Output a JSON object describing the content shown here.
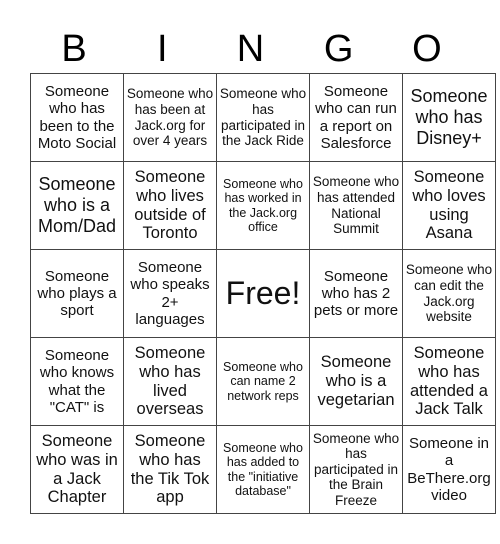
{
  "header": {
    "letters": [
      "B",
      "I",
      "N",
      "G",
      "O"
    ]
  },
  "board": {
    "rows": [
      [
        {
          "text": "Someone who has been to the Moto Social",
          "size": "md"
        },
        {
          "text": "Someone who has been at Jack.org for over 4 years",
          "size": "sm"
        },
        {
          "text": "Someone who has participated in the Jack Ride",
          "size": "sm"
        },
        {
          "text": "Someone who can run a report on Salesforce",
          "size": "md"
        },
        {
          "text": "Someone who has Disney+",
          "size": "xl"
        }
      ],
      [
        {
          "text": "Someone who is a Mom/Dad",
          "size": "xl"
        },
        {
          "text": "Someone who lives outside of Toronto",
          "size": "lg"
        },
        {
          "text": "Someone who has worked in the Jack.org office",
          "size": "xs"
        },
        {
          "text": "Someone who has attended National Summit",
          "size": "sm"
        },
        {
          "text": "Someone who loves using Asana",
          "size": "lg"
        }
      ],
      [
        {
          "text": "Someone who plays a sport",
          "size": "md"
        },
        {
          "text": "Someone who speaks 2+ languages",
          "size": "md"
        },
        {
          "text": "Free!",
          "size": "free"
        },
        {
          "text": "Someone who has 2 pets or more",
          "size": "md"
        },
        {
          "text": "Someone who can edit the Jack.org website",
          "size": "sm"
        }
      ],
      [
        {
          "text": "Someone who knows what the \"CAT\" is",
          "size": "md"
        },
        {
          "text": "Someone who has lived overseas",
          "size": "lg"
        },
        {
          "text": "Someone who can name 2 network reps",
          "size": "xs"
        },
        {
          "text": "Someone who is a vegetarian",
          "size": "lg"
        },
        {
          "text": "Someone who has attended a Jack Talk",
          "size": "lg"
        }
      ],
      [
        {
          "text": "Someone who was in a Jack Chapter",
          "size": "lg"
        },
        {
          "text": "Someone who has the Tik Tok app",
          "size": "lg"
        },
        {
          "text": "Someone who has added to the \"initiative database\"",
          "size": "xs"
        },
        {
          "text": "Someone who has participated in the Brain Freeze",
          "size": "sm"
        },
        {
          "text": "Someone in a BeThere.org video",
          "size": "md"
        }
      ]
    ]
  },
  "colors": {
    "grid_border": "#444444",
    "text": "#111111",
    "background": "#ffffff"
  }
}
